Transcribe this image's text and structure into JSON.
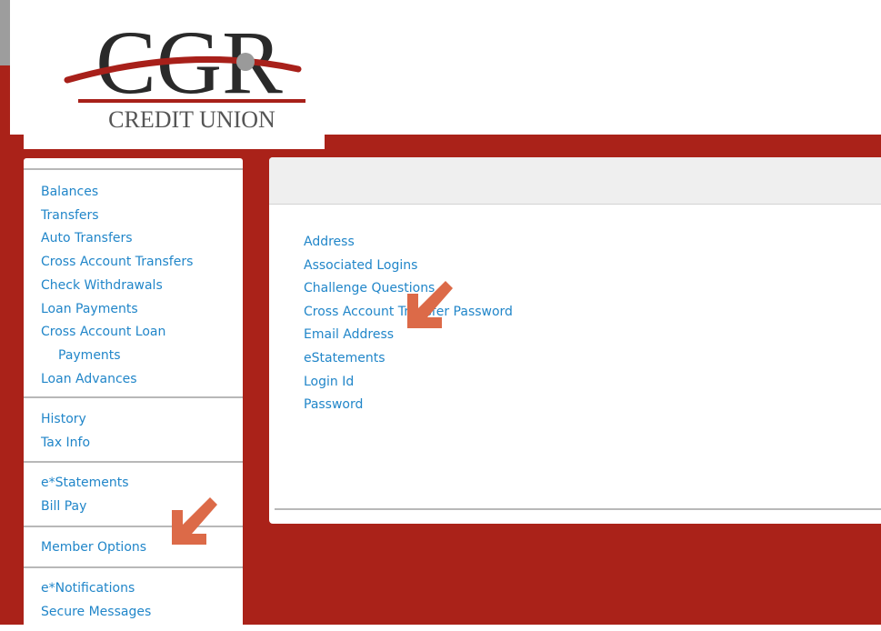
{
  "brand": {
    "logo_letters": "CGR",
    "logo_tagline": "CREDIT UNION"
  },
  "colors": {
    "brand_red": "#aa2219",
    "link_blue": "#2186c9",
    "arrow_orange": "#dc6a48",
    "logo_dark": "#2a2a2a",
    "logo_red": "#a8201a"
  },
  "sidebar": {
    "group1": [
      "Balances",
      "Transfers",
      "Auto Transfers",
      "Cross Account Transfers",
      "Check Withdrawals",
      "Loan Payments",
      "Cross Account Loan",
      "Payments",
      "Loan Advances"
    ],
    "group2": [
      "History",
      "Tax Info"
    ],
    "group3": [
      "e*Statements",
      "Bill Pay"
    ],
    "group4": [
      "Member Options"
    ],
    "group5": [
      "e*Notifications",
      "Secure Messages"
    ]
  },
  "member_options": [
    "Address",
    "Associated Logins",
    "Challenge Questions",
    "Cross Account Transfer Password",
    "Email Address",
    "eStatements",
    "Login Id",
    "Password"
  ],
  "annotations": {
    "arrow_icon": "down-left-arrow-icon"
  }
}
